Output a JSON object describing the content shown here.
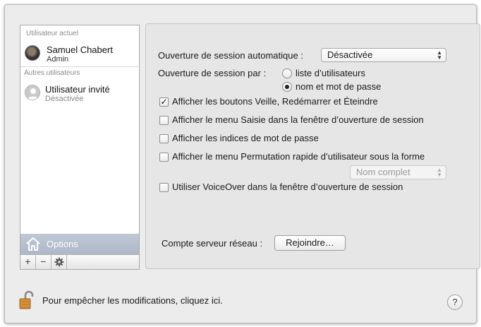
{
  "sidebar": {
    "current_user_header": "Utilisateur actuel",
    "current_user": {
      "name": "Samuel Chabert",
      "role": "Admin"
    },
    "other_users_header": "Autres utilisateurs",
    "guest_user": {
      "name": "Utilisateur invité",
      "status": "Désactivée"
    },
    "options_label": "Options",
    "toolbar": {
      "add": "+",
      "remove": "−",
      "gear": "gear-icon"
    }
  },
  "login": {
    "auto_login_label": "Ouverture de session automatique :",
    "auto_login_value": "Désactivée",
    "display_label": "Ouverture de session par :",
    "display_options": [
      "liste d’utilisateurs",
      "nom et mot de passe"
    ],
    "display_selected": 1
  },
  "checkboxes": [
    {
      "label": "Afficher les boutons Veille, Redémarrer et Éteindre",
      "checked": true
    },
    {
      "label": "Afficher le menu Saisie dans la fenêtre d’ouverture de session",
      "checked": false
    },
    {
      "label": "Afficher les indices de mot de passe",
      "checked": false
    },
    {
      "label": "Afficher le menu Permutation rapide d’utilisateur sous la forme",
      "checked": false
    },
    {
      "label": "Utiliser VoiceOver dans la fenêtre d’ouverture de session",
      "checked": false
    }
  ],
  "fast_switch_popup": {
    "value": "Nom complet"
  },
  "network_server": {
    "label": "Compte serveur réseau :",
    "button": "Rejoindre…"
  },
  "footer": {
    "lock_text": "Pour empêcher les modifications, cliquez ici.",
    "help": "?"
  },
  "colors": {
    "selected_row": "#b6bfce",
    "window_bg": "#ececec",
    "panel_bg": "#e6e6e6"
  }
}
